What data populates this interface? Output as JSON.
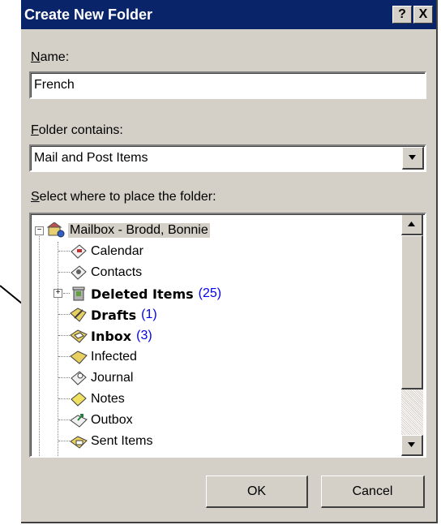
{
  "dialog": {
    "title": "Create New Folder",
    "help_button": "?",
    "close_button": "X"
  },
  "name_field": {
    "label_key": "N",
    "label_rest": "ame:",
    "value": "French"
  },
  "contains_field": {
    "label_key": "F",
    "label_rest": "older contains:",
    "value": "Mail and Post Items"
  },
  "location": {
    "label_key": "S",
    "label_rest": "elect where to place the folder:"
  },
  "tree": {
    "root": {
      "label": "Mailbox - Brodd, Bonnie",
      "icon": "mailbox-icon",
      "expander": "−"
    },
    "items": [
      {
        "label": "Calendar",
        "count": "",
        "bold": false,
        "icon": "calendar-icon"
      },
      {
        "label": "Contacts",
        "count": "",
        "bold": false,
        "icon": "contacts-icon"
      },
      {
        "label": "Deleted Items",
        "count": "(25)",
        "bold": true,
        "icon": "deleted-items-icon",
        "expander": "+"
      },
      {
        "label": "Drafts",
        "count": "(1)",
        "bold": true,
        "icon": "drafts-icon"
      },
      {
        "label": "Inbox",
        "count": "(3)",
        "bold": true,
        "icon": "inbox-icon"
      },
      {
        "label": "Infected",
        "count": "",
        "bold": false,
        "icon": "folder-icon"
      },
      {
        "label": "Journal",
        "count": "",
        "bold": false,
        "icon": "journal-icon"
      },
      {
        "label": "Notes",
        "count": "",
        "bold": false,
        "icon": "notes-icon"
      },
      {
        "label": "Outbox",
        "count": "",
        "bold": false,
        "icon": "outbox-icon"
      },
      {
        "label": "Sent Items",
        "count": "",
        "bold": false,
        "icon": "sent-items-icon"
      }
    ]
  },
  "buttons": {
    "ok": "OK",
    "cancel": "Cancel"
  },
  "colors": {
    "titlebar": "#0a246a",
    "face": "#d4d0c8",
    "count": "#0000ee",
    "selection": "#d4d0c8"
  }
}
